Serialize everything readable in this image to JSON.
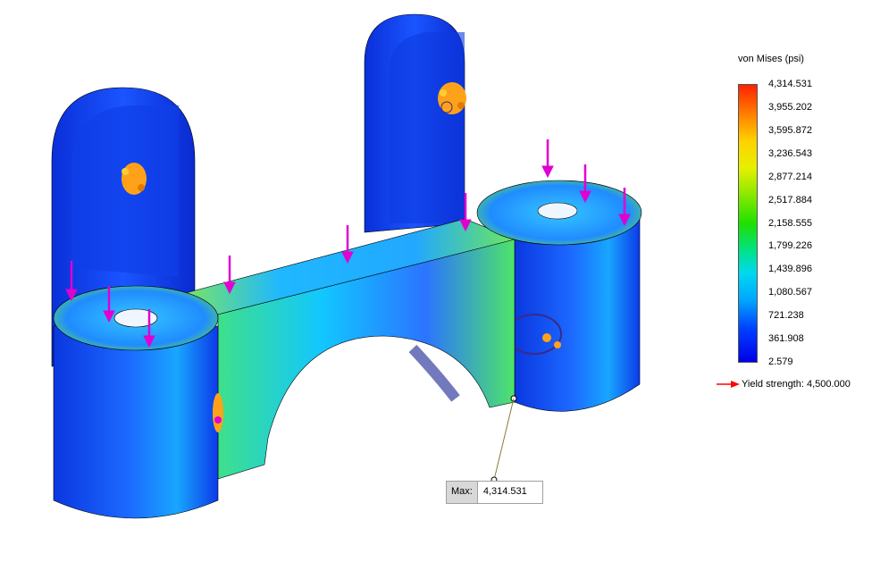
{
  "legend": {
    "title": "von Mises (psi)",
    "ticks": [
      "4,314.531",
      "3,955.202",
      "3,595.872",
      "3,236.543",
      "2,877.214",
      "2,517.884",
      "2,158.555",
      "1,799.226",
      "1,439.896",
      "1,080.567",
      "721.238",
      "361.908",
      "2.579"
    ],
    "yield_label": "Yield strength: 4,500.000"
  },
  "max_probe": {
    "label": "Max:",
    "value": "4,314.531"
  },
  "colors": {
    "load_arrow": "#e000d0",
    "fixture": "#ff9a00",
    "yield_arrow": "#ff0000"
  }
}
